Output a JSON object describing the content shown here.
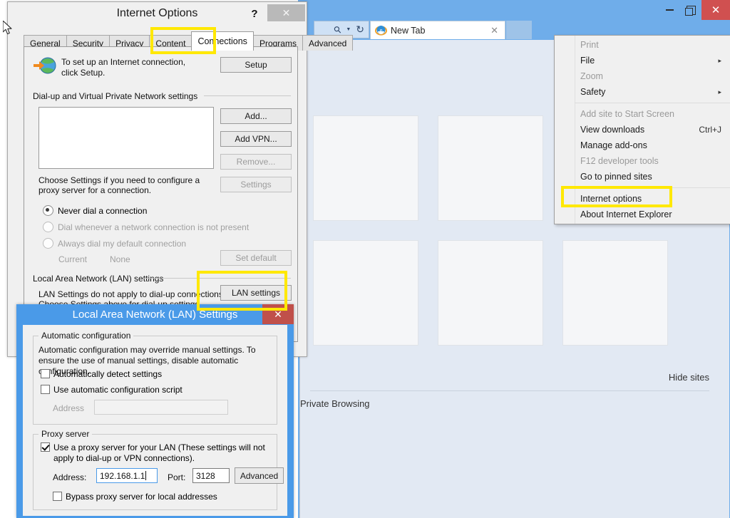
{
  "browser": {
    "window_controls": {
      "minimize": "–",
      "restore": "❐",
      "close": "✕"
    },
    "toolbar": {
      "search_icon": "search-icon",
      "dropdown_icon": "caret-down-icon",
      "refresh_icon": "refresh-icon",
      "home_icon": "home-icon",
      "favorites_icon": "star-icon",
      "tools_icon": "gear-icon"
    },
    "tab": {
      "title": "New Tab",
      "close_label": "✕",
      "favicon": "ie-logo-icon"
    },
    "new_tab_button_label": "",
    "page": {
      "tiles": [
        {
          "id": "tile-1"
        },
        {
          "id": "tile-2"
        },
        {
          "id": "tile-3"
        },
        {
          "id": "tile-4"
        },
        {
          "id": "tile-5"
        },
        {
          "id": "tile-6"
        }
      ],
      "hide_sites_link": "Hide sites",
      "private_browsing_label": "Private Browsing"
    }
  },
  "tools_menu": {
    "items": [
      {
        "label": "Print",
        "enabled": false,
        "submenu": true,
        "shortcut": ""
      },
      {
        "label": "File",
        "enabled": true,
        "submenu": true,
        "shortcut": ""
      },
      {
        "label": "Zoom",
        "enabled": false,
        "submenu": true,
        "shortcut": ""
      },
      {
        "label": "Safety",
        "enabled": true,
        "submenu": true,
        "shortcut": ""
      },
      {
        "separator": true
      },
      {
        "label": "Add site to Start Screen",
        "enabled": false,
        "submenu": false,
        "shortcut": ""
      },
      {
        "label": "View downloads",
        "enabled": true,
        "submenu": false,
        "shortcut": "Ctrl+J"
      },
      {
        "label": "Manage add-ons",
        "enabled": true,
        "submenu": false,
        "shortcut": ""
      },
      {
        "label": "F12 developer tools",
        "enabled": false,
        "submenu": false,
        "shortcut": ""
      },
      {
        "label": "Go to pinned sites",
        "enabled": true,
        "submenu": false,
        "shortcut": ""
      },
      {
        "separator": true
      },
      {
        "label": "Internet options",
        "enabled": true,
        "submenu": false,
        "shortcut": "",
        "highlighted": true
      },
      {
        "label": "About Internet Explorer",
        "enabled": true,
        "submenu": false,
        "shortcut": ""
      }
    ],
    "submenu_arrow": "▸"
  },
  "internet_options": {
    "title": "Internet Options",
    "help_label": "?",
    "close_label": "✕",
    "tabs": [
      {
        "label": "General",
        "active": false
      },
      {
        "label": "Security",
        "active": false
      },
      {
        "label": "Privacy",
        "active": false
      },
      {
        "label": "Content",
        "active": false
      },
      {
        "label": "Connections",
        "active": true
      },
      {
        "label": "Programs",
        "active": false
      },
      {
        "label": "Advanced",
        "active": false
      }
    ],
    "setup": {
      "text": "To set up an Internet connection, click Setup.",
      "button_label": "Setup"
    },
    "dialup": {
      "group_label": "Dial-up and Virtual Private Network settings",
      "list_items": [],
      "buttons": [
        {
          "label": "Add...",
          "enabled": true
        },
        {
          "label": "Add VPN...",
          "enabled": true
        },
        {
          "label": "Remove...",
          "enabled": false
        },
        {
          "label": "Settings",
          "enabled": false
        }
      ],
      "hint": "Choose Settings if you need to configure a proxy server for a connection.",
      "radios": [
        {
          "label": "Never dial a connection",
          "checked": true,
          "enabled": true
        },
        {
          "label": "Dial whenever a network connection is not present",
          "checked": false,
          "enabled": false
        },
        {
          "label": "Always dial my default connection",
          "checked": false,
          "enabled": false
        }
      ],
      "current_label": "Current",
      "current_value": "None",
      "set_default_label": "Set default"
    },
    "lan": {
      "group_label": "Local Area Network (LAN) settings",
      "note_line1": "LAN Settings do not apply to dial-up connections.",
      "note_line2": "Choose Settings above for dial-up settings.",
      "button_label": "LAN settings"
    }
  },
  "lan_settings": {
    "title": "Local Area Network (LAN) Settings",
    "close_label": "✕",
    "automatic_configuration": {
      "legend": "Automatic configuration",
      "description": "Automatic configuration may override manual settings.  To ensure the use of manual settings, disable automatic configuration.",
      "auto_detect": {
        "label": "Automatically detect settings",
        "checked": false
      },
      "use_script": {
        "label": "Use automatic configuration script",
        "checked": false
      },
      "address_label": "Address",
      "address_value": "",
      "address_enabled": false
    },
    "proxy_server": {
      "legend": "Proxy server",
      "use_proxy": {
        "label": "Use a proxy server for your LAN (These settings will not apply to dial-up or VPN connections).",
        "checked": true
      },
      "address_label": "Address:",
      "address_value": "192.168.1.1",
      "port_label": "Port:",
      "port_value": "3128",
      "advanced_label": "Advanced",
      "bypass": {
        "label": "Bypass proxy server for local addresses",
        "checked": false
      }
    }
  },
  "highlights": {
    "color": "#ffe800",
    "regions": [
      "connections-tab",
      "lan-settings-button",
      "internet-options-menu-item"
    ]
  }
}
